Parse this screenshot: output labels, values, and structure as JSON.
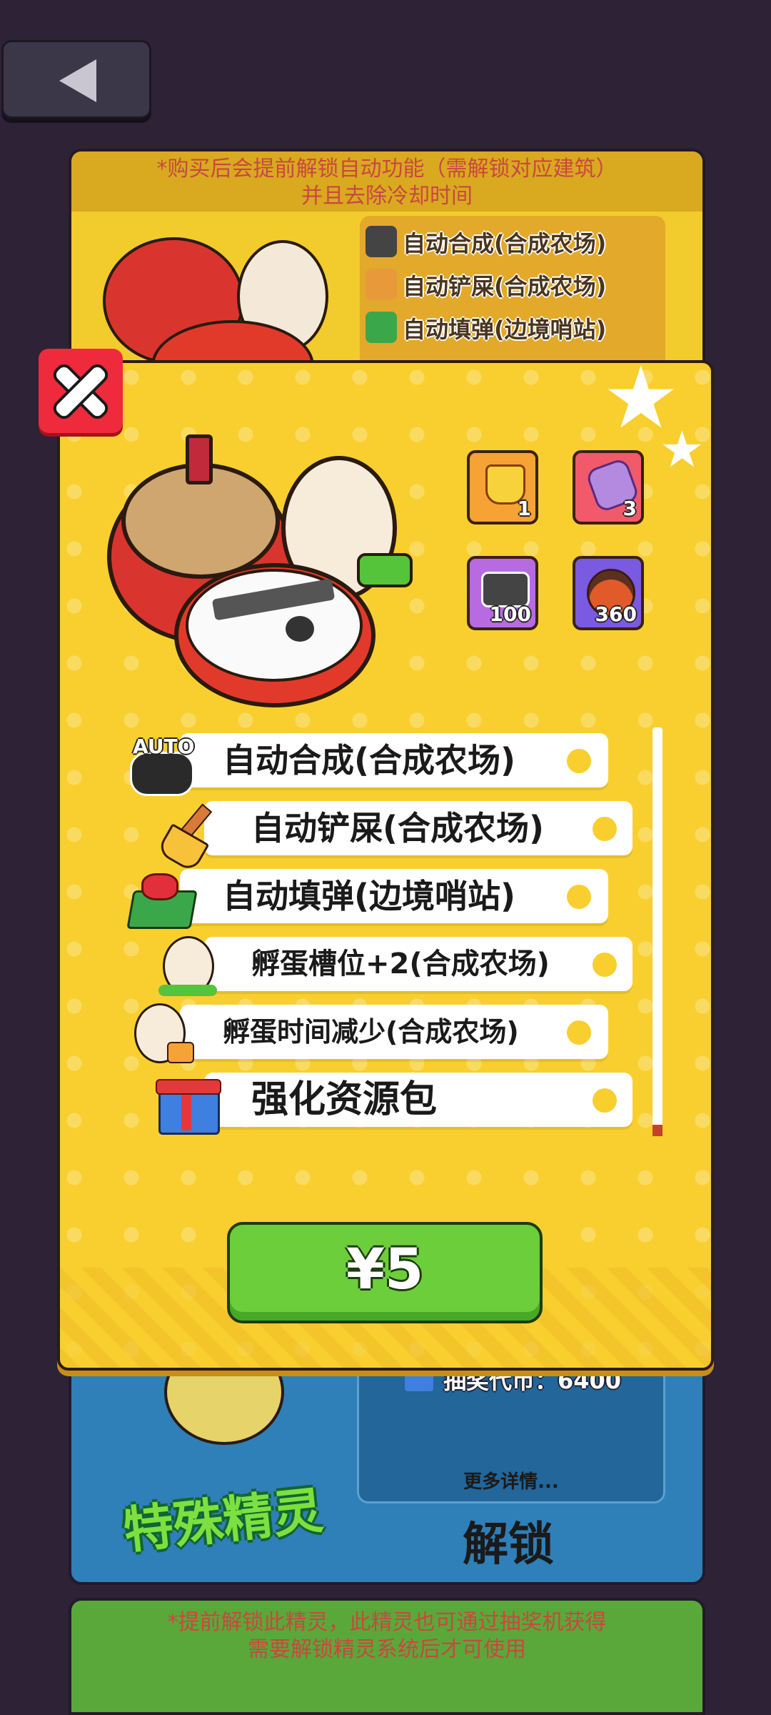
{
  "background_top": {
    "notice": "*购买后会提前解锁自动功能（需解锁对应建筑）",
    "notice_line2": "并且去除冷却时间",
    "features": [
      {
        "label": "自动合成(合成农场)",
        "icon": "auto-icon",
        "icon_text": "AUTO"
      },
      {
        "label": "自动铲屎(合成农场)",
        "icon": "broom-icon"
      },
      {
        "label": "自动填弹(边境哨站)",
        "icon": "ammo-box-icon"
      }
    ]
  },
  "background_bottom": {
    "lottery_label": "抽奖代币：6400",
    "more_details": "更多详情...",
    "unlock_label": "解锁",
    "special_spirit": "特殊精灵",
    "notice": "*提前解锁此精灵，此精灵也可通过抽奖机获得",
    "notice_line2": "需要解锁精灵系统后才可使用"
  },
  "modal": {
    "rewards": [
      {
        "icon": "crown-icon",
        "qty": "1",
        "color": "#f7a234"
      },
      {
        "icon": "potion-jar-icon",
        "qty": "3",
        "color": "#f05a6a"
      },
      {
        "icon": "robot-icon",
        "qty": "100",
        "color": "#b86be0"
      },
      {
        "icon": "coffee-jar-icon",
        "qty": "360",
        "color": "#7a5ae0"
      }
    ],
    "rows": [
      {
        "label": "自动合成(合成农场)",
        "icon": "auto-icon",
        "icon_text": "AUTO"
      },
      {
        "label": "自动铲屎(合成农场)",
        "icon": "broom-icon"
      },
      {
        "label": "自动填弹(边境哨站)",
        "icon": "ammo-box-icon"
      },
      {
        "label": "孵蛋槽位+2(合成农场)",
        "icon": "egg-icon"
      },
      {
        "label": "孵蛋时间减少(合成农场)",
        "icon": "egg-speed-icon"
      },
      {
        "label": "强化资源包",
        "icon": "gift-icon"
      }
    ],
    "price": "¥5"
  },
  "colors": {
    "background": "#2d2236",
    "modal": "#f8cf2e",
    "buy_button": "#6cce3a",
    "close_button": "#ee2a3c"
  }
}
